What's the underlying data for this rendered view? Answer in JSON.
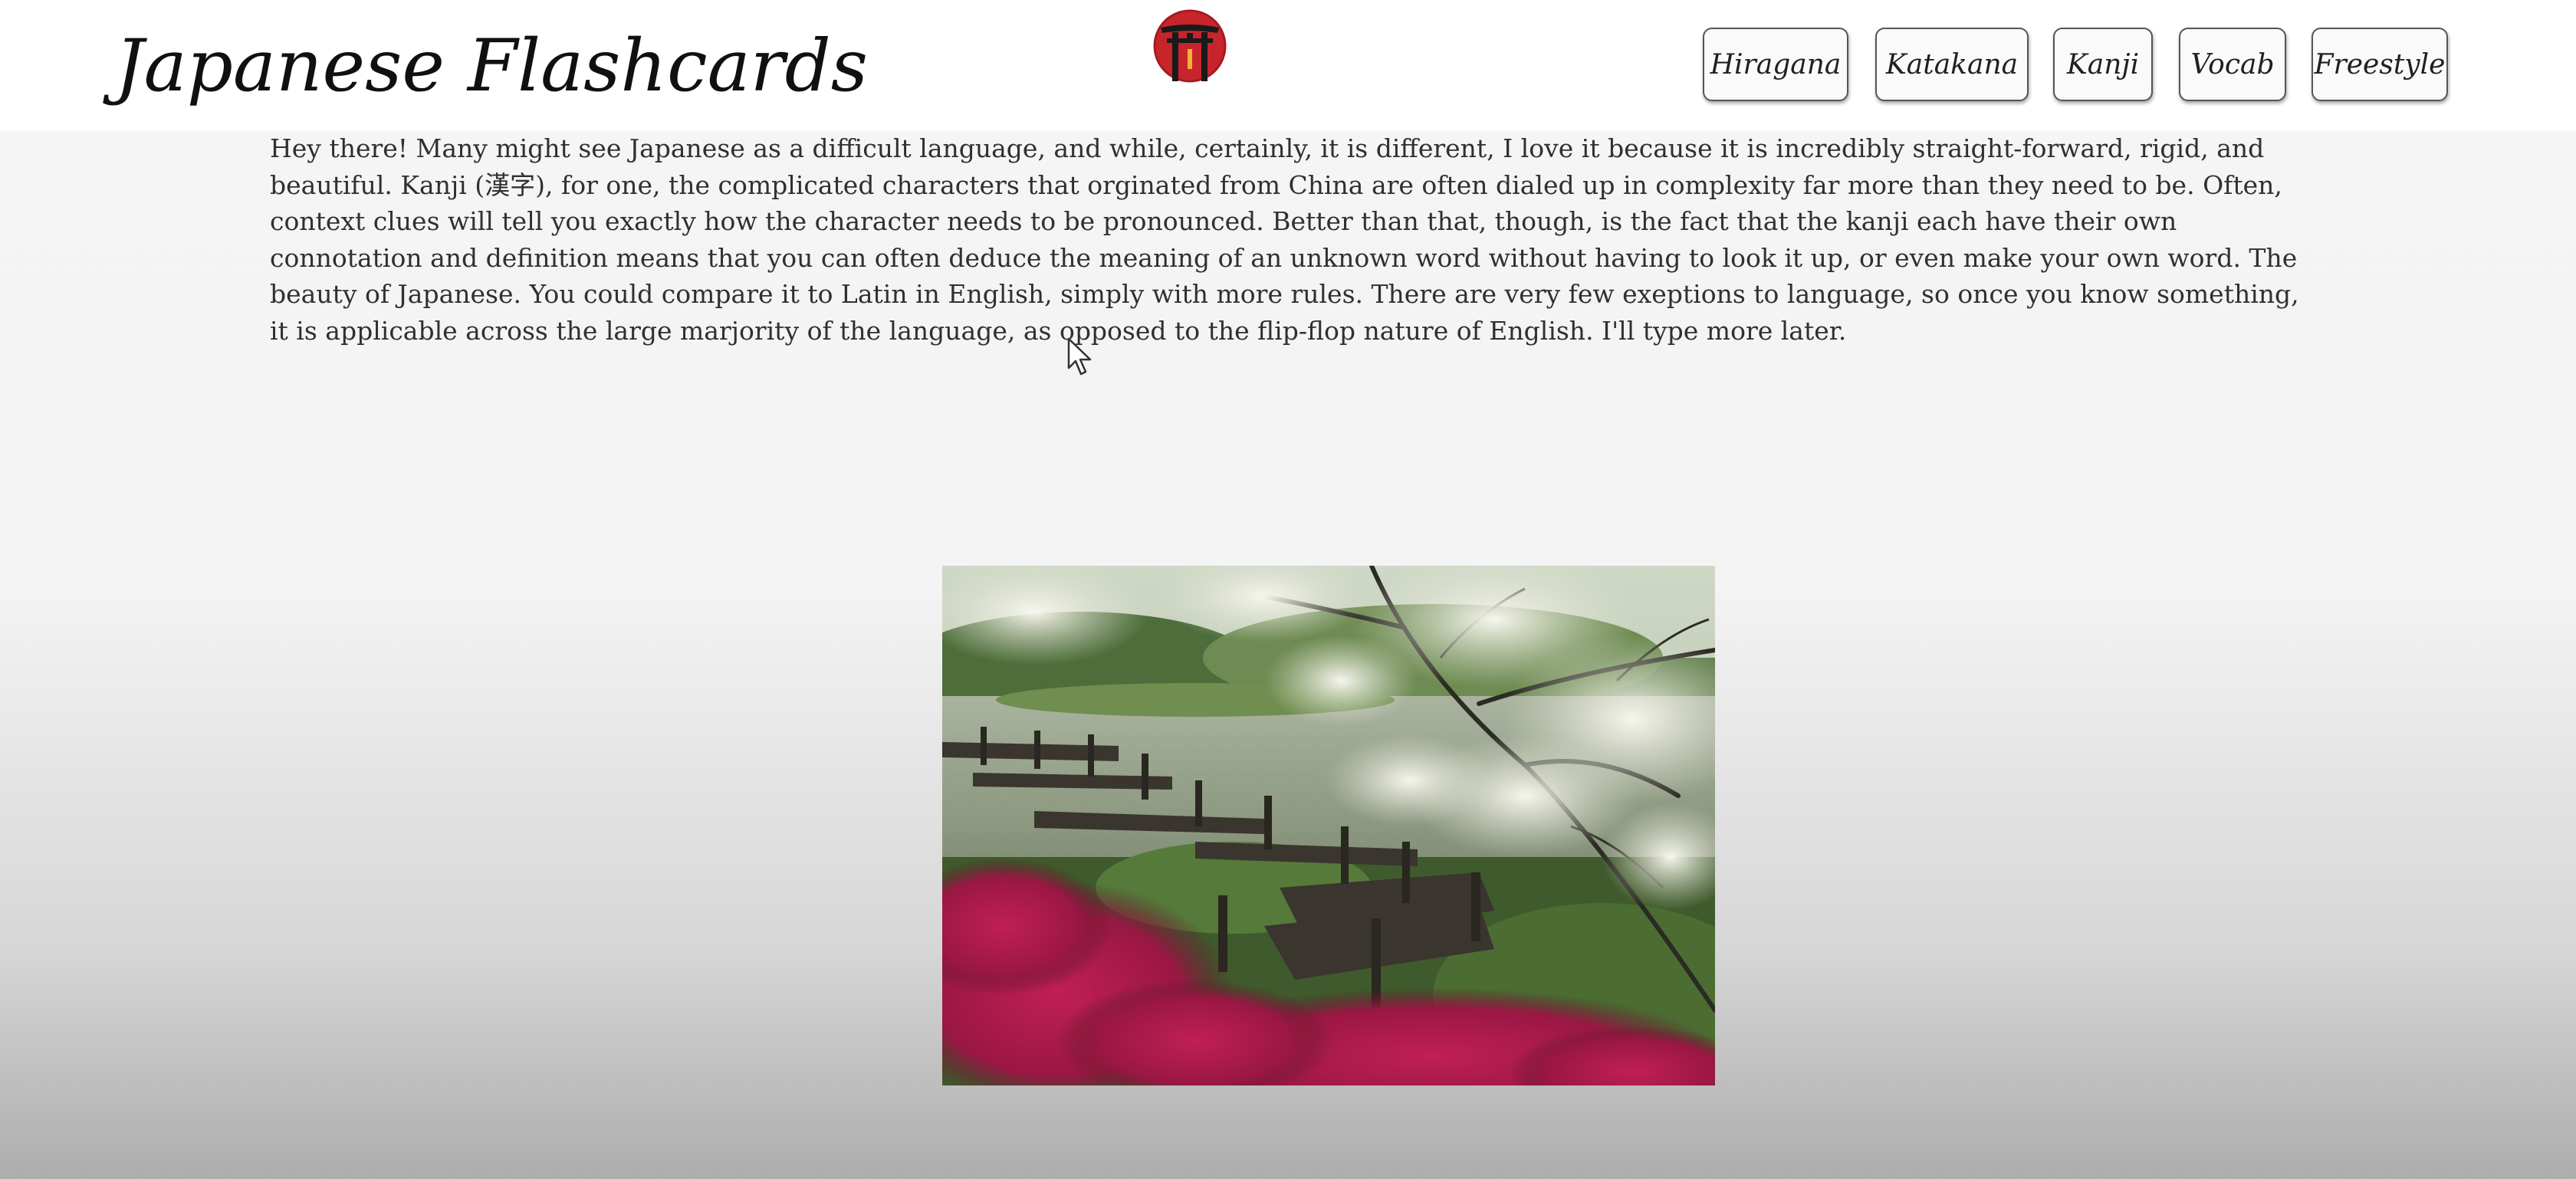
{
  "header": {
    "site_title": "Japanese Flashcards",
    "logo_icon": "torii-gate-icon",
    "brand_red": "#c8242b"
  },
  "nav": {
    "items": [
      {
        "label": "Hiragana"
      },
      {
        "label": "Katakana"
      },
      {
        "label": "Kanji"
      },
      {
        "label": "Vocab"
      },
      {
        "label": "Freestyle"
      }
    ]
  },
  "main": {
    "intro_text": "Hey there! Many might see Japanese as a difficult language, and while, certainly, it is different, I love it because it is incredibly straight-forward, rigid, and beautiful. Kanji (漢字), for one, the complicated characters that orginated from China are often dialed up in complexity far more than they need to be. Often, context clues will tell you exactly how the character needs to be pronounced. Better than that, though, is the fact that the kanji each have their own connotation and definition means that you can often deduce the meaning of an unknown word without having to look it up, or even make your own word. The beauty of Japanese. You could compare it to Latin in English, simply with more rules. There are very few exeptions to language, so once you know something, it is applicable across the large marjority of the language, as opposed to the flip-flop nature of English. I'll type more later.",
    "image_subject": "japanese-garden-photo"
  },
  "cursor_icon": "mouse-pointer-icon"
}
